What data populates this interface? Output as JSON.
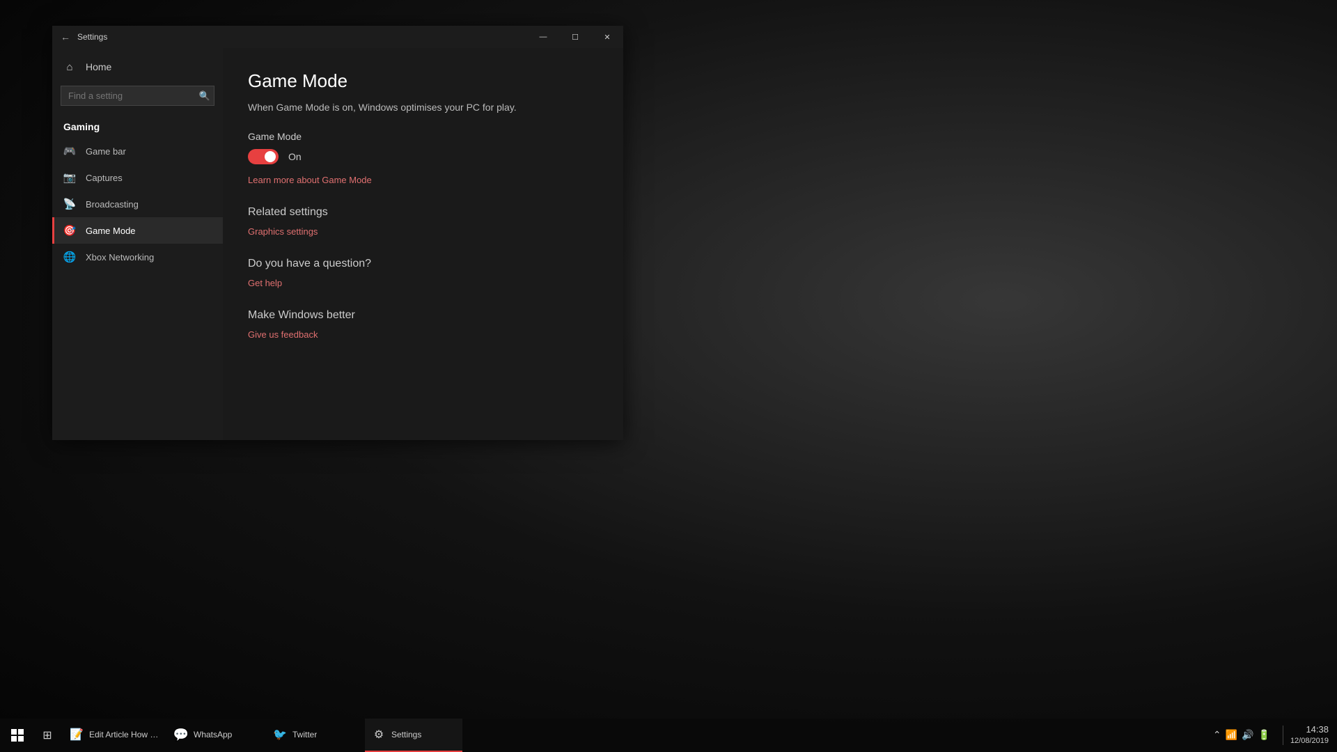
{
  "window": {
    "title": "Settings",
    "minimize_label": "—",
    "maximize_label": "☐",
    "close_label": "✕"
  },
  "sidebar": {
    "home_label": "Home",
    "search_placeholder": "Find a setting",
    "section_label": "Gaming",
    "nav_items": [
      {
        "id": "game-bar",
        "label": "Game bar",
        "icon": "🎮"
      },
      {
        "id": "captures",
        "label": "Captures",
        "icon": "📷"
      },
      {
        "id": "broadcasting",
        "label": "Broadcasting",
        "icon": "📡"
      },
      {
        "id": "game-mode",
        "label": "Game Mode",
        "icon": "🎯",
        "active": true
      },
      {
        "id": "xbox-networking",
        "label": "Xbox Networking",
        "icon": "🌐"
      }
    ]
  },
  "main": {
    "title": "Game Mode",
    "description": "When Game Mode is on, Windows optimises your PC for play.",
    "game_mode_label": "Game Mode",
    "toggle_state": "On",
    "learn_more_link": "Learn more about Game Mode",
    "related_settings_heading": "Related settings",
    "graphics_settings_link": "Graphics settings",
    "question_heading": "Do you have a question?",
    "get_help_link": "Get help",
    "make_better_heading": "Make Windows better",
    "give_feedback_link": "Give us feedback"
  },
  "taskbar": {
    "apps": [
      {
        "id": "edit-article",
        "label": "Edit Article How to...",
        "icon": "📝"
      },
      {
        "id": "whatsapp",
        "label": "WhatsApp",
        "icon": "💬"
      },
      {
        "id": "twitter",
        "label": "Twitter",
        "icon": "🐦"
      },
      {
        "id": "settings",
        "label": "Settings",
        "icon": "⚙",
        "active": true
      }
    ],
    "time": "14:38",
    "date": "12/08/2019"
  }
}
